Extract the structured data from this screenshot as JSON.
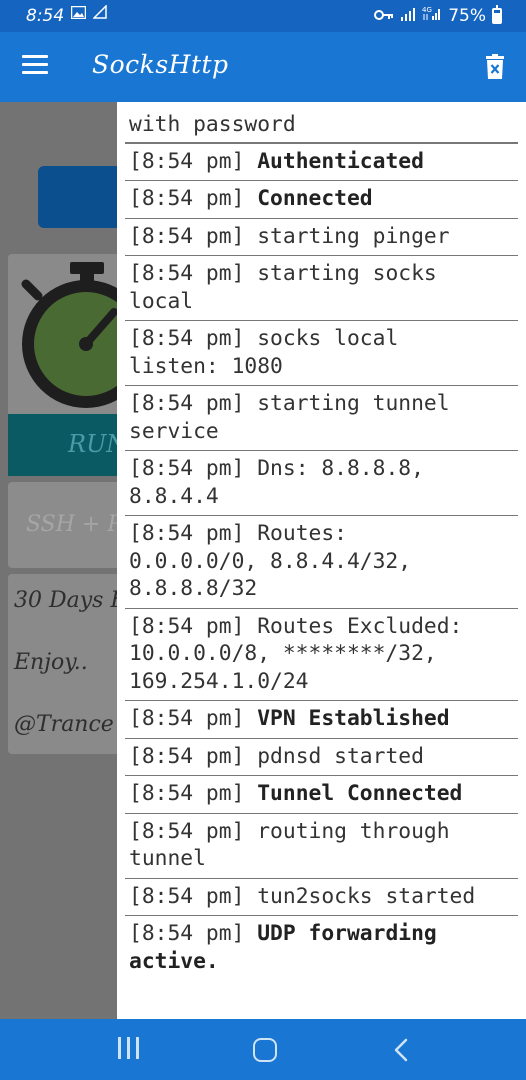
{
  "status_bar": {
    "time": "8:54",
    "battery": "75%"
  },
  "app_bar": {
    "title": "SocksHttp"
  },
  "background": {
    "run_label": "RUN",
    "config_placeholder": "SSH + P",
    "notes": [
      "30 Days F",
      "Enjoy..",
      "@Trance"
    ]
  },
  "log": {
    "entries": [
      {
        "text": "with password",
        "bold": false
      },
      {
        "time": "[8:54 pm]",
        "text": "Authenticated",
        "bold": true
      },
      {
        "time": "[8:54 pm]",
        "text": "Connected",
        "bold": true
      },
      {
        "time": "[8:54 pm]",
        "text": "starting pinger",
        "bold": false
      },
      {
        "time": "[8:54 pm]",
        "text": "starting socks\nlocal",
        "bold": false
      },
      {
        "time": "[8:54 pm]",
        "text": "socks local\nlisten: 1080",
        "bold": false
      },
      {
        "time": "[8:54 pm]",
        "text": "starting tunnel\nservice",
        "bold": false
      },
      {
        "time": "[8:54 pm]",
        "text": "Dns: 8.8.8.8,\n8.8.4.4",
        "bold": false
      },
      {
        "time": "[8:54 pm]",
        "text": "Routes:\n0.0.0.0/0, 8.8.4.4/32,\n8.8.8.8/32",
        "bold": false
      },
      {
        "time": "[8:54 pm]",
        "text": "Routes Excluded:\n10.0.0.0/8, ********/32,\n169.254.1.0/24",
        "bold": false
      },
      {
        "time": "[8:54 pm]",
        "text": "VPN Established",
        "bold": true
      },
      {
        "time": "[8:54 pm]",
        "text": "pdnsd started",
        "bold": false
      },
      {
        "time": "[8:54 pm]",
        "text": "Tunnel Connected",
        "bold": true
      },
      {
        "time": "[8:54 pm]",
        "text": "routing through\ntunnel",
        "bold": false
      },
      {
        "time": "[8:54 pm]",
        "text": "tun2socks started",
        "bold": false
      },
      {
        "time": "[8:54 pm]",
        "text": "UDP forwarding\nactive.",
        "bold": true
      }
    ]
  },
  "colors": {
    "status_bar": "#1565c0",
    "app_bar": "#1976d2",
    "nav_bar": "#1976d2",
    "scrim": "#737373"
  }
}
